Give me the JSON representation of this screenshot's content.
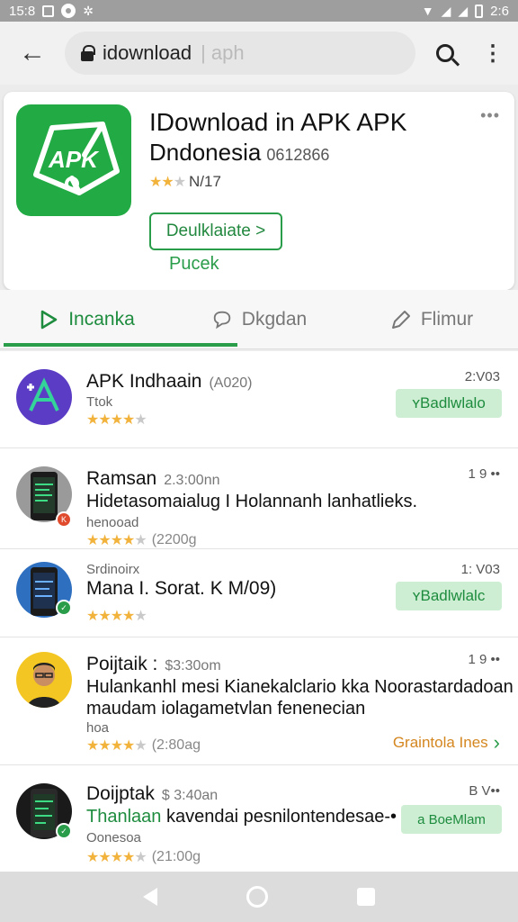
{
  "status_bar": {
    "time": "15:8",
    "right_text": "2:6"
  },
  "browser": {
    "url_text": "idownload",
    "url_suffix": "| aph"
  },
  "app": {
    "title": "IDownload in APK APK",
    "subtitle": "Dndonesia",
    "code": "0612866",
    "rating_text": "N/17",
    "download_label": "Deulklaiate >",
    "more_label": "Pucek",
    "icon_text": "APK",
    "brand_color": "#22aa44"
  },
  "tabs": [
    {
      "label": "Incanka",
      "icon": "play-icon",
      "active": true
    },
    {
      "label": "Dkgdan",
      "icon": "chat-icon",
      "active": false
    },
    {
      "label": "Flimur",
      "icon": "edit-icon",
      "active": false
    }
  ],
  "list": [
    {
      "title": "APK Indhaain",
      "meta": "(A020)",
      "sub": "Ttok",
      "time": "2:V03",
      "action": "ʏBadlwlalo"
    },
    {
      "title": "Ramsan",
      "meta": "2.3:00nn",
      "line": "Hidetasomaialug I Holannanh lanhatlieks.",
      "sub": "henooad",
      "rating_count": "(2200g",
      "time": "1 9 ••"
    },
    {
      "pre": "Srdinoirx",
      "title": "Mana I. Sorat. K M/09)",
      "time": "1: V03",
      "action": "ʏBadlwlalc"
    },
    {
      "title": "Poijtaik :",
      "meta": "$3:30om",
      "line": "Hulankanhl mesi Kianekalclario kka Noorastardadoan",
      "line2": "maudam iolagametvlan fenenecian",
      "sub": "hoa",
      "rating_count": "(2:80ag",
      "time": "1 9 ••",
      "link": "Graintola Ines"
    },
    {
      "title": "Doijptak",
      "meta": "$ 3:40an",
      "line_green": "Thanlaan",
      "line": "kavendai pesnilontendesae-•",
      "sub": "Oonesoa",
      "rating_count": "(21:00g",
      "time": "B V••",
      "action": "a BoeMlam"
    }
  ]
}
